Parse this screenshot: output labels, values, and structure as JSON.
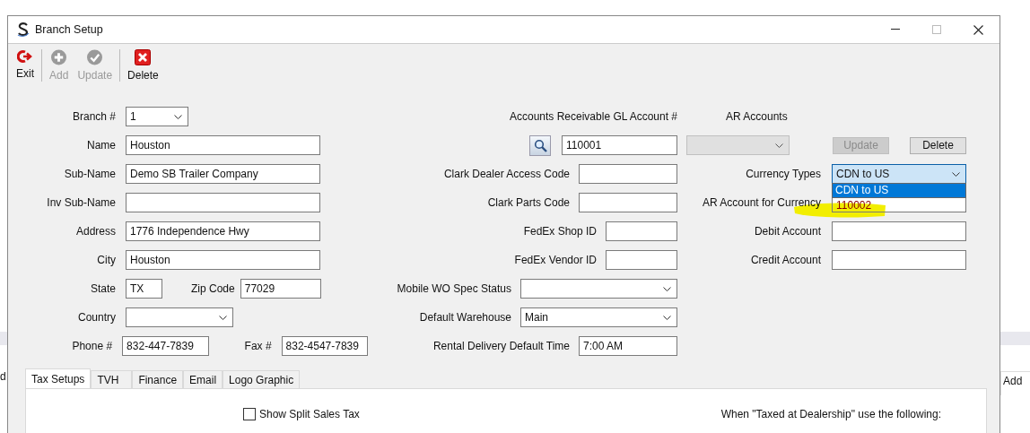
{
  "window": {
    "title": "Branch Setup"
  },
  "toolbar": [
    {
      "kind": "exit",
      "label": "Exit",
      "disabled": false
    },
    {
      "kind": "add",
      "label": "Add",
      "disabled": true
    },
    {
      "kind": "update",
      "label": "Update",
      "disabled": true
    },
    {
      "kind": "delete",
      "label": "Delete",
      "disabled": false
    }
  ],
  "branch_fields": [
    {
      "label": "Branch #",
      "kind": "select",
      "value": "1"
    },
    {
      "label": "Name",
      "kind": "input",
      "value": "Houston"
    },
    {
      "label": "Sub-Name",
      "kind": "input",
      "value": "Demo SB Trailer Company"
    },
    {
      "label": "Inv Sub-Name",
      "kind": "input"
    },
    {
      "label": "Address",
      "kind": "input",
      "value": "1776 Independence Hwy"
    },
    {
      "label": "City",
      "kind": "input",
      "value": "Houston"
    },
    {
      "label": "State",
      "kind": "input",
      "value": "TX",
      "extra": {
        "label": "Zip Code",
        "value": "77029"
      }
    },
    {
      "label": "Country",
      "kind": "select"
    },
    {
      "label": "Phone #",
      "kind": "input",
      "value": "832-447-7839",
      "extra": {
        "label": "Fax #",
        "value": "832-4547-7839"
      }
    }
  ],
  "gl_account": {
    "label": "Accounts Receivable GL Account #",
    "value": "110001"
  },
  "dealer_fields": [
    {
      "label": "Clark Dealer Access Code",
      "kind": "input"
    },
    {
      "label": "Clark Parts Code",
      "kind": "input"
    },
    {
      "label": "FedEx Shop ID",
      "kind": "input"
    },
    {
      "label": "FedEx Vendor ID",
      "kind": "input"
    },
    {
      "label": "Mobile WO Spec Status",
      "kind": "select"
    },
    {
      "label": "Default Warehouse",
      "kind": "select",
      "value": "Main"
    },
    {
      "label": "Rental Delivery Default Time",
      "kind": "input",
      "value": "7:00 AM"
    }
  ],
  "ar_accounts": {
    "label": "AR Accounts",
    "buttons": [
      {
        "label": "Update",
        "disabled": true
      },
      {
        "label": "Delete",
        "disabled": false
      }
    ]
  },
  "currency_fields": [
    {
      "label": "Currency Types",
      "kind": "select",
      "value": "CDN to US",
      "expanded": true,
      "options": [
        {
          "label": "CDN to US",
          "selected": true
        }
      ]
    },
    {
      "label": "AR Account for Currency",
      "kind": "input",
      "value": "110002",
      "highlighted": true
    },
    {
      "label": "Debit Account",
      "kind": "input"
    },
    {
      "label": "Credit Account",
      "kind": "input"
    }
  ],
  "tabs": [
    {
      "label": "Tax Setups",
      "selected": true
    },
    {
      "label": "TVH",
      "selected": false
    },
    {
      "label": "Finance",
      "selected": false
    },
    {
      "label": "Email",
      "selected": false
    },
    {
      "label": "Logo Graphic",
      "selected": false
    }
  ],
  "tax_setups": {
    "checkbox": {
      "label": "Show Split Sales Tax",
      "checked": false
    },
    "note": "When \"Taxed at Dealership\" use the following:"
  },
  "background_app": {
    "left_text": "d",
    "right_text": "Add"
  }
}
